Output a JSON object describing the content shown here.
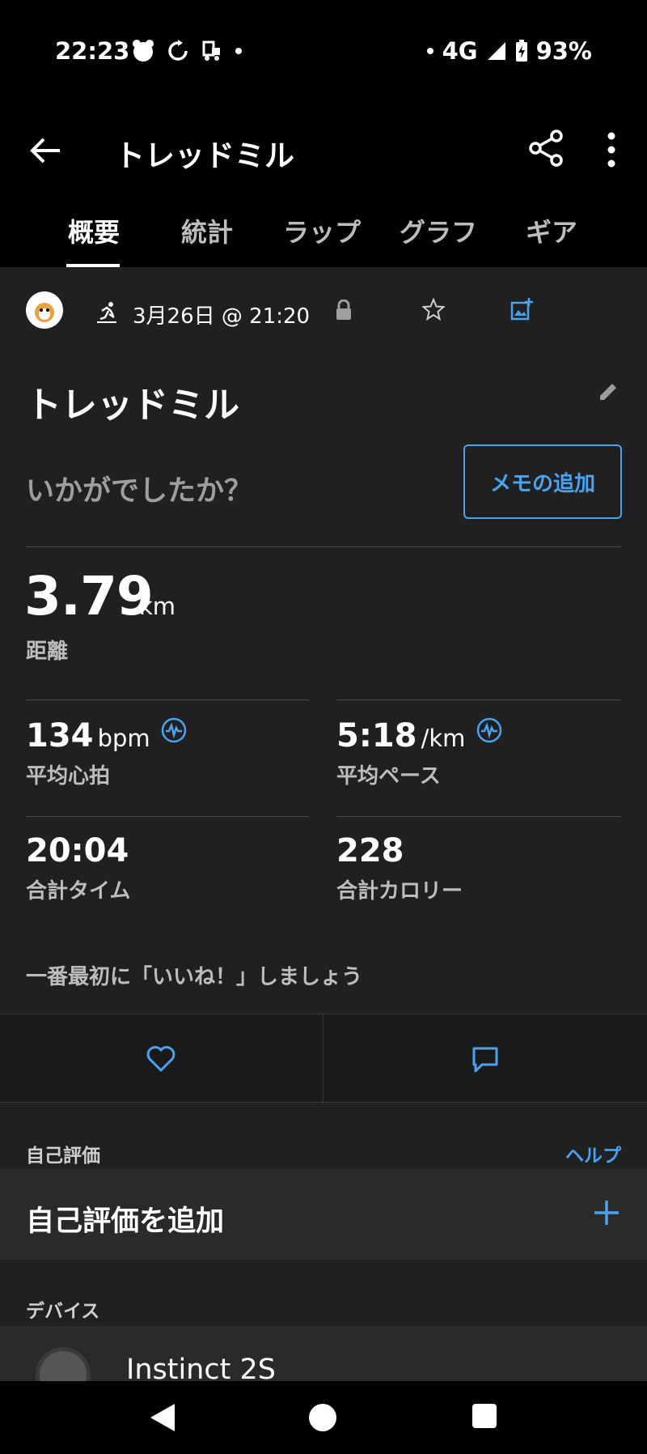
{
  "status_bar": {
    "time": "22:23",
    "network": "4G",
    "battery": "93%"
  },
  "app_bar": {
    "title": "トレッドミル"
  },
  "tabs": [
    {
      "label": "概要",
      "active": true
    },
    {
      "label": "統計",
      "active": false
    },
    {
      "label": "ラップ",
      "active": false
    },
    {
      "label": "グラフ",
      "active": false
    },
    {
      "label": "ギア",
      "active": false
    }
  ],
  "activity": {
    "date": "3月26日 @ 21:20",
    "title": "トレッドミル",
    "prompt": "いかがでしたか？",
    "memo_button": "メモの追加"
  },
  "summary": {
    "distance": {
      "value": "3.79",
      "unit": "km",
      "label": "距離"
    },
    "heart_rate": {
      "value": "134",
      "unit": "bpm",
      "label": "平均心拍"
    },
    "pace": {
      "value": "5:18",
      "unit": "/km",
      "label": "平均ペース"
    },
    "time": {
      "value": "20:04",
      "label": "合計タイム"
    },
    "calories": {
      "value": "228",
      "label": "合計カロリー"
    }
  },
  "social": {
    "first_like": "一番最初に「いいね！」しましょう"
  },
  "self_evaluation": {
    "section_label": "自己評価",
    "help": "ヘルプ",
    "add_label": "自己評価を追加"
  },
  "device": {
    "section_label": "デバイス",
    "name": "Instinct 2S"
  },
  "colors": {
    "accent": "#4aa3f0",
    "background": "#202020",
    "bar": "#000000"
  }
}
